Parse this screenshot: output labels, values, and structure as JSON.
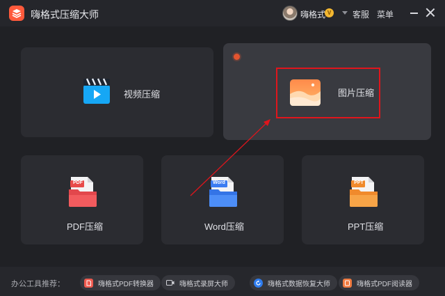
{
  "app": {
    "title": "嗨格式压缩大师"
  },
  "header": {
    "username": "嗨格式",
    "vip_badge": "V",
    "service_label": "客服",
    "menu_label": "菜单"
  },
  "cards": {
    "video": {
      "label": "视频压缩"
    },
    "image": {
      "label": "图片压缩"
    },
    "pdf": {
      "label": "PDF压缩",
      "badge": "PDF"
    },
    "word": {
      "label": "Word压缩",
      "badge": "Word"
    },
    "ppt": {
      "label": "PPT压缩",
      "badge": "PPT"
    }
  },
  "footer": {
    "office_label": "办公工具推荐：",
    "tools": [
      {
        "label": "嗨格式PDF转换器",
        "icon": "pdf-converter-icon"
      },
      {
        "label": "嗨格式录屏大师",
        "icon": "screen-recorder-icon"
      },
      {
        "label": "嗨格式数据恢复大师",
        "icon": "data-recovery-icon"
      },
      {
        "label": "嗨格式PDF阅读器",
        "icon": "pdf-reader-icon"
      }
    ]
  },
  "colors": {
    "accent": "#ff5a3c",
    "highlight": "#e0151c",
    "background": "#202125",
    "card": "#2b2c31",
    "card_active": "#393a40"
  }
}
